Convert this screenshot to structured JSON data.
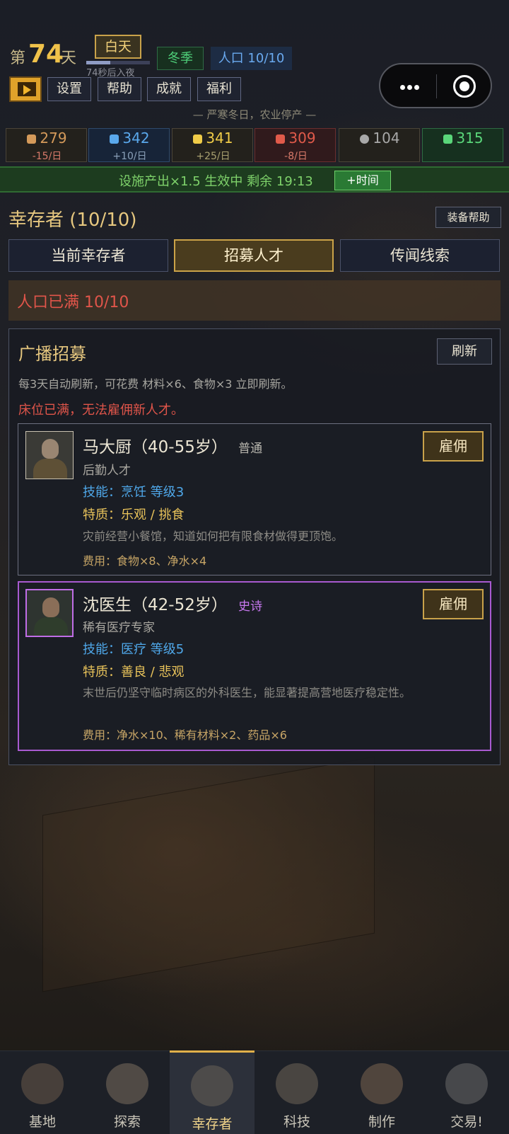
{
  "header": {
    "day_prefix": "第",
    "day_number": "74",
    "day_suffix": "天",
    "daytime": "白天",
    "night_countdown": "74秒后入夜",
    "night_progress": 0.38,
    "season": "冬季",
    "population": "人口 10/10",
    "menu": [
      "设置",
      "帮助",
      "成就",
      "福利"
    ],
    "notice": "— 严寒冬日，农业停产 —"
  },
  "resources": [
    {
      "icon": "food-icon",
      "value": "279",
      "rate": "-15/日",
      "color": "#d49a5a",
      "rate_color": "#d87a6a"
    },
    {
      "icon": "water-icon",
      "value": "342",
      "rate": "+10/日",
      "color": "#5aa8ec",
      "rate_color": "#8aa0b8"
    },
    {
      "icon": "energy-icon",
      "value": "341",
      "rate": "+25/日",
      "color": "#f0cc48",
      "rate_color": "#a8a070"
    },
    {
      "icon": "fuel-icon",
      "value": "309",
      "rate": "-8/日",
      "color": "#e05a4a",
      "rate_color": "#d87a6a"
    },
    {
      "icon": "gear-icon",
      "value": "104",
      "rate": "",
      "color": "#a8a8a8",
      "rate_color": "#a8a8a8"
    },
    {
      "icon": "medicine-icon",
      "value": "315",
      "rate": "",
      "color": "#5ad67a",
      "rate_color": "#a8a8a8"
    }
  ],
  "boost": {
    "text": "设施产出×1.5 生效中 剩余 19:13",
    "button": "+时间"
  },
  "survivors": {
    "title": "幸存者 (10/10)",
    "equip_help": "装备帮助",
    "tabs": [
      "当前幸存者",
      "招募人才",
      "传闻线索"
    ],
    "active_tab": 1,
    "population_full": "人口已满 10/10"
  },
  "recruit": {
    "title": "广播招募",
    "refresh": "刷新",
    "description": "每3天自动刷新，可花费 材料×6、食物×3 立即刷新。",
    "bed_warning": "床位已满，无法雇佣新人才。",
    "hire_label": "雇佣",
    "candidates": [
      {
        "name": "马大厨（40-55岁）",
        "rarity": "普通",
        "rarity_color": "#b8b6ae",
        "role": "后勤人才",
        "skill": "技能：烹饪 等级3",
        "traits": "特质：乐观 / 挑食",
        "description": "灾前经营小餐馆，知道如何把有限食材做得更顶饱。",
        "cost": "费用：食物×8、净水×4"
      },
      {
        "name": "沈医生（42-52岁）",
        "rarity": "史诗",
        "rarity_color": "#c878f0",
        "role": "稀有医疗专家",
        "skill": "技能：医疗 等级5",
        "traits": "特质：善良 / 悲观",
        "description": "末世后仍坚守临时病区的外科医生，能显著提高营地医疗稳定性。",
        "cost": "费用：净水×10、稀有材料×2、药品×6"
      }
    ]
  },
  "nav": [
    {
      "label": "基地",
      "icon": "base-icon"
    },
    {
      "label": "探索",
      "icon": "compass-icon"
    },
    {
      "label": "幸存者",
      "icon": "survivors-icon"
    },
    {
      "label": "科技",
      "icon": "tech-icon"
    },
    {
      "label": "制作",
      "icon": "craft-icon"
    },
    {
      "label": "交易!",
      "icon": "trade-icon"
    }
  ],
  "active_nav": 2
}
